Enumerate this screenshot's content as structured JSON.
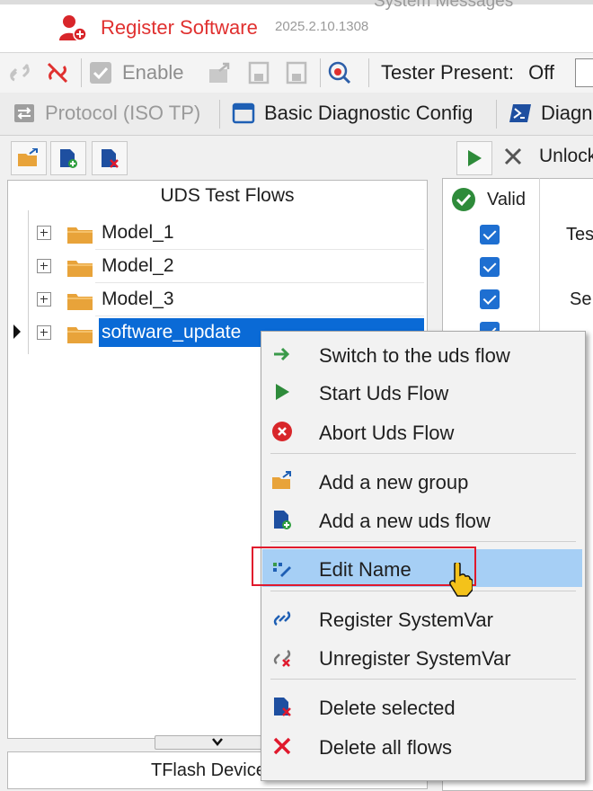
{
  "header": {
    "ghost_text": "System Messages",
    "title": "Register Software",
    "version": "2025.2.10.1308"
  },
  "toolbar": {
    "enable_label": "Enable",
    "tester_present_label": "Tester Present:",
    "tester_present_value": "Off"
  },
  "tabs": [
    {
      "label": "Protocol (ISO TP)"
    },
    {
      "label": "Basic Diagnostic Config"
    },
    {
      "label": "Diagn"
    }
  ],
  "actions": {
    "unlock_label": "Unlock"
  },
  "tree": {
    "header": "UDS Test Flows",
    "items": [
      {
        "label": "Model_1"
      },
      {
        "label": "Model_2"
      },
      {
        "label": "Model_3"
      },
      {
        "label": "software_update"
      }
    ]
  },
  "table": {
    "valid_header": "Valid",
    "col2_fragments": [
      "Tes",
      "",
      "Se"
    ]
  },
  "bottom": {
    "tflash_label": "TFlash Device List"
  },
  "context_menu": {
    "items": [
      {
        "label": "Switch to the uds flow",
        "icon": "arrow-right-icon"
      },
      {
        "label": "Start Uds Flow",
        "icon": "play-icon"
      },
      {
        "label": "Abort Uds Flow",
        "icon": "abort-icon"
      },
      {
        "label": "Add a new group",
        "icon": "add-group-icon"
      },
      {
        "label": "Add a new uds flow",
        "icon": "add-flow-icon"
      },
      {
        "label": "Edit Name",
        "icon": "edit-name-icon"
      },
      {
        "label": "Register SystemVar",
        "icon": "link-icon"
      },
      {
        "label": "Unregister SystemVar",
        "icon": "unlink-icon"
      },
      {
        "label": "Delete selected",
        "icon": "delete-selected-icon"
      },
      {
        "label": "Delete all flows",
        "icon": "delete-all-icon"
      }
    ]
  },
  "colors": {
    "title_red": "#e0302f",
    "selection_blue": "#0a6ad6",
    "menu_highlight": "#a6cff5",
    "highlight_box": "#e0192d"
  }
}
